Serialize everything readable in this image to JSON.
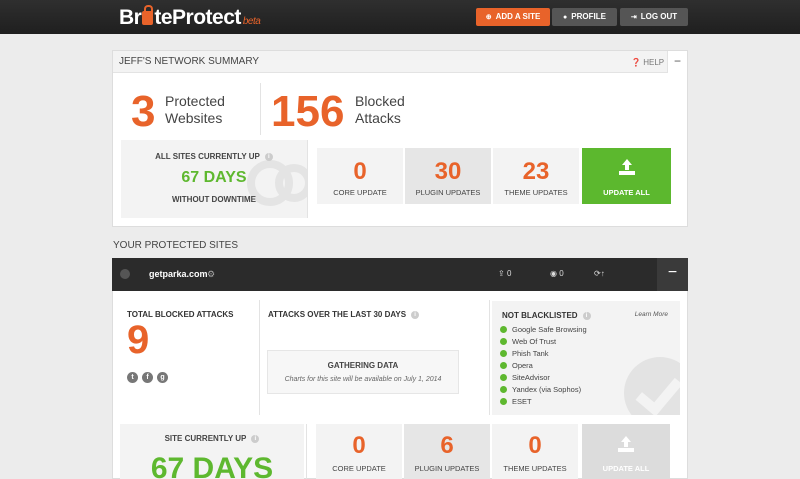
{
  "header": {
    "logo_text_1": "Br",
    "logo_text_2": "teProtect",
    "logo_badge": "beta",
    "buttons": [
      {
        "label": "ADD A SITE",
        "icon": "plus-circle-icon"
      },
      {
        "label": "PROFILE",
        "icon": "user-icon"
      },
      {
        "label": "LOG OUT",
        "icon": "logout-icon"
      }
    ]
  },
  "summary": {
    "title": "JEFF'S NETWORK SUMMARY",
    "help_label": "HELP",
    "collapse_symbol": "−",
    "protected_count": "3",
    "protected_label_1": "Protected",
    "protected_label_2": "Websites",
    "blocked_count": "156",
    "blocked_label_1": "Blocked",
    "blocked_label_2": "Attacks",
    "uptime_top": "ALL SITES CURRENTLY UP",
    "uptime_days": "67 DAYS",
    "uptime_bottom": "WITHOUT DOWNTIME",
    "stats": [
      {
        "value": "0",
        "label": "CORE UPDATE"
      },
      {
        "value": "30",
        "label": "PLUGIN UPDATES"
      },
      {
        "value": "23",
        "label": "THEME UPDATES"
      }
    ],
    "update_all_label": "UPDATE ALL"
  },
  "protected_sites": {
    "title": "YOUR PROTECTED SITES",
    "site": {
      "name": "getparka.com",
      "bar_stat_1": "0",
      "bar_stat_2": "0",
      "collapse_symbol": "−",
      "total_blocked_label": "TOTAL BLOCKED ATTACKS",
      "total_blocked_value": "9",
      "attacks_30_label": "ATTACKS OVER THE LAST 30 DAYS",
      "gathering_title": "GATHERING DATA",
      "gathering_sub": "Charts for this site will be available on July 1, 2014",
      "blacklist_label": "NOT BLACKLISTED",
      "learn_more": "Learn More",
      "blacklist_items": [
        "Google Safe Browsing",
        "Web Of Trust",
        "Phish Tank",
        "Opera",
        "SiteAdvisor",
        "Yandex (via Sophos)",
        "ESET"
      ],
      "uptime_top": "SITE CURRENTLY UP",
      "uptime_days": "67 DAYS",
      "stats": [
        {
          "value": "0",
          "label": "CORE UPDATE"
        },
        {
          "value": "6",
          "label": "PLUGIN UPDATES"
        },
        {
          "value": "0",
          "label": "THEME UPDATES"
        }
      ],
      "update_all_label": "UPDATE ALL"
    }
  },
  "colors": {
    "accent": "#e8632a",
    "success": "#5cb82e",
    "topbar": "#2b2b2b"
  }
}
